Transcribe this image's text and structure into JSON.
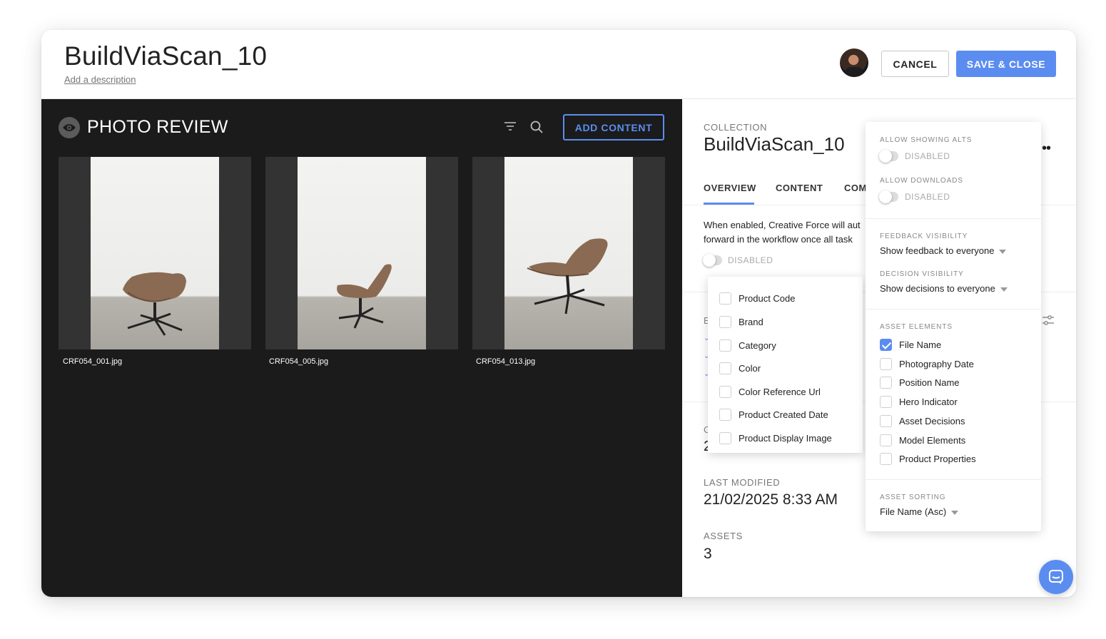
{
  "header": {
    "title": "BuildViaScan_10",
    "add_description": "Add a description",
    "cancel_label": "CANCEL",
    "save_label": "SAVE & CLOSE"
  },
  "review": {
    "title": "PHOTO REVIEW",
    "add_content_label": "ADD CONTENT",
    "icons": [
      "eye-icon",
      "filter-icon",
      "search-icon"
    ],
    "assets": [
      {
        "file": "CRF054_001.jpg"
      },
      {
        "file": "CRF054_005.jpg"
      },
      {
        "file": "CRF054_013.jpg"
      }
    ]
  },
  "collection": {
    "label": "COLLECTION",
    "name": "BuildViaScan_10",
    "tabs": [
      "OVERVIEW",
      "CONTENT",
      "COM"
    ],
    "active_tab": "OVERVIEW",
    "overview_text": [
      "When enabled, Creative Force will aut",
      "forward in the workflow once all task"
    ],
    "overview_toggle": "DISABLED",
    "fragments": {
      "e": "E",
      "c": "C",
      "two": "2"
    },
    "last_modified_label": "LAST MODIFIED",
    "last_modified_value": "21/02/2025 8:33 AM",
    "assets_label": "ASSETS",
    "assets_value": "3"
  },
  "field_dropdown": {
    "items": [
      {
        "label": "Product Code",
        "checked": false
      },
      {
        "label": "Brand",
        "checked": false
      },
      {
        "label": "Category",
        "checked": false
      },
      {
        "label": "Color",
        "checked": false
      },
      {
        "label": "Color Reference Url",
        "checked": false
      },
      {
        "label": "Product Created Date",
        "checked": false
      },
      {
        "label": "Product Display Image",
        "checked": false
      }
    ]
  },
  "settings": {
    "allow_alts_label": "ALLOW SHOWING ALTS",
    "allow_alts_state": "DISABLED",
    "allow_downloads_label": "ALLOW DOWNLOADS",
    "allow_downloads_state": "DISABLED",
    "feedback_label": "FEEDBACK VISIBILITY",
    "feedback_value": "Show feedback to everyone",
    "decision_label": "DECISION VISIBILITY",
    "decision_value": "Show decisions to everyone",
    "asset_elements_label": "ASSET ELEMENTS",
    "asset_elements": [
      {
        "label": "File Name",
        "checked": true
      },
      {
        "label": "Photography Date",
        "checked": false
      },
      {
        "label": "Position Name",
        "checked": false
      },
      {
        "label": "Hero Indicator",
        "checked": false
      },
      {
        "label": "Asset Decisions",
        "checked": false
      },
      {
        "label": "Model Elements",
        "checked": false
      },
      {
        "label": "Product Properties",
        "checked": false
      }
    ],
    "sorting_label": "ASSET SORTING",
    "sorting_value": "File Name (Asc)"
  },
  "colors": {
    "accent": "#5b8df0",
    "dark_panel": "#1b1b1b"
  }
}
